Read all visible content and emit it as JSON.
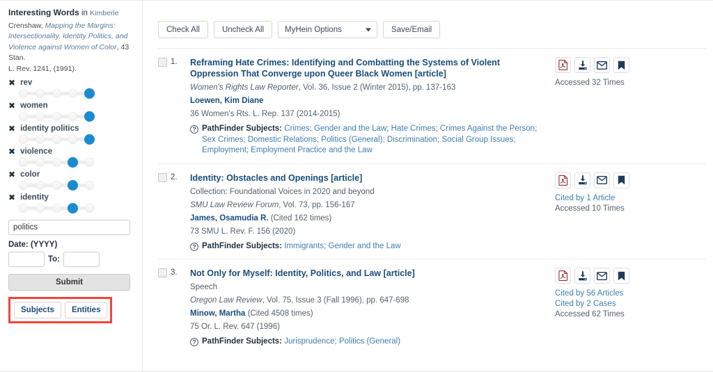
{
  "sidebar": {
    "heading": {
      "title": "Interesting Words",
      "in": " in ",
      "author": "Kimberle"
    },
    "citation": {
      "line1_plain": "Crenshaw, ",
      "line1_italic": "Mapping the Margins:",
      "line2_italic": "Intersectionality, Identity Politics, and",
      "line3_italic": "Violence against Women of Color",
      "line3_plain": ", 43 Stan.",
      "line4_plain": "L. Rev. 1241, (1991)."
    },
    "sliders": [
      {
        "label": "rev",
        "value": 5,
        "max": 5,
        "remove_icon": "close-icon"
      },
      {
        "label": "women",
        "value": 5,
        "max": 5,
        "remove_icon": "close-icon"
      },
      {
        "label": "identity politics",
        "value": 5,
        "max": 5,
        "remove_icon": "close-icon"
      },
      {
        "label": "violence",
        "value": 4,
        "max": 5,
        "remove_icon": "close-icon"
      },
      {
        "label": "color",
        "value": 4,
        "max": 5,
        "remove_icon": "close-icon"
      },
      {
        "label": "identity",
        "value": 4,
        "max": 5,
        "remove_icon": "close-icon"
      }
    ],
    "keyword_input": {
      "value": "politics",
      "placeholder": ""
    },
    "date_label": "Date: (YYYY)",
    "date_from": {
      "value": "",
      "placeholder": ""
    },
    "date_to_label": "To:",
    "date_to": {
      "value": "",
      "placeholder": ""
    },
    "submit_label": "Submit",
    "highlight_color": "#f4433a",
    "tabs": [
      {
        "label": "Subjects",
        "active": true
      },
      {
        "label": "Entities",
        "active": false
      }
    ]
  },
  "toolbar": {
    "check_all": "Check All",
    "uncheck_all": "Uncheck All",
    "myhein_options": "MyHein Options",
    "save_email": "Save/Email"
  },
  "results": [
    {
      "number": "1.",
      "title": "Reframing Hate Crimes: Identifying and Combatting the Systems of Violent Oppression That Converge upon Queer Black Women [article]",
      "collection": "",
      "source_italic": "Women's Rights Law Reporter",
      "source_rest": ", Vol. 36, Issue 2 (Winter 2015), pp. 137-163",
      "author": "Loewen, Kim Diane",
      "author_cited": "",
      "citation": "36 Women's Rts. L. Rep. 137 (2014-2015)",
      "pathfinder_label": "PathFinder Subjects:",
      "pathfinder_subjects": "Crimes; Gender and the Law; Hate Crimes; Crimes Against the Person; Sex Crimes; Domestic Relations; Politics (General); Discrimination; Social Group Issues; Employment; Employment Practice and the Law",
      "stats": [
        {
          "text": "Accessed 32 Times",
          "link": false
        }
      ],
      "icons": [
        "pdf-icon",
        "download-icon",
        "email-icon",
        "bookmark-icon"
      ]
    },
    {
      "number": "2.",
      "title": "Identity: Obstacles and Openings [article]",
      "collection": "Collection: Foundational Voices in 2020 and beyond",
      "source_italic": "SMU Law Review Forum",
      "source_rest": ", Vol. 73, pp. 156-167",
      "author": "James, Osamudia R.",
      "author_cited": " (Cited 162 times)",
      "citation": "73 SMU L. Rev. F. 156 (2020)",
      "pathfinder_label": "PathFinder Subjects:",
      "pathfinder_subjects": "Immigrants; Gender and the Law",
      "stats": [
        {
          "text": "Cited by 1 Article",
          "link": true
        },
        {
          "text": "Accessed 10 Times",
          "link": false
        }
      ],
      "icons": [
        "pdf-icon",
        "download-icon",
        "email-icon",
        "bookmark-icon"
      ]
    },
    {
      "number": "3.",
      "title": "Not Only for Myself: Identity, Politics, and Law [article]",
      "collection": "Speech",
      "source_italic": "Oregon Law Review",
      "source_rest": ", Vol. 75, Issue 3 (Fall 1996), pp. 647-698",
      "author": "Minow, Martha",
      "author_cited": " (Cited 4508 times)",
      "citation": "75 Or. L. Rev. 647 (1996)",
      "pathfinder_label": "PathFinder Subjects:",
      "pathfinder_subjects": "Jurisprudence; Politics (General)",
      "stats": [
        {
          "text": "Cited by 56 Articles",
          "link": true
        },
        {
          "text": "Cited by 2 Cases",
          "link": true
        },
        {
          "text": "Accessed 62 Times",
          "link": false
        }
      ],
      "icons": [
        "pdf-icon",
        "download-icon",
        "email-icon",
        "bookmark-icon"
      ]
    }
  ],
  "colors": {
    "link": "#1a4d7a",
    "subject_link": "#3f7fb0",
    "slider_thumb": "#1b8bd0",
    "pdf_red": "#9e2a2b",
    "icon_navy": "#1f3a5f",
    "highlight": "#f4433a"
  }
}
